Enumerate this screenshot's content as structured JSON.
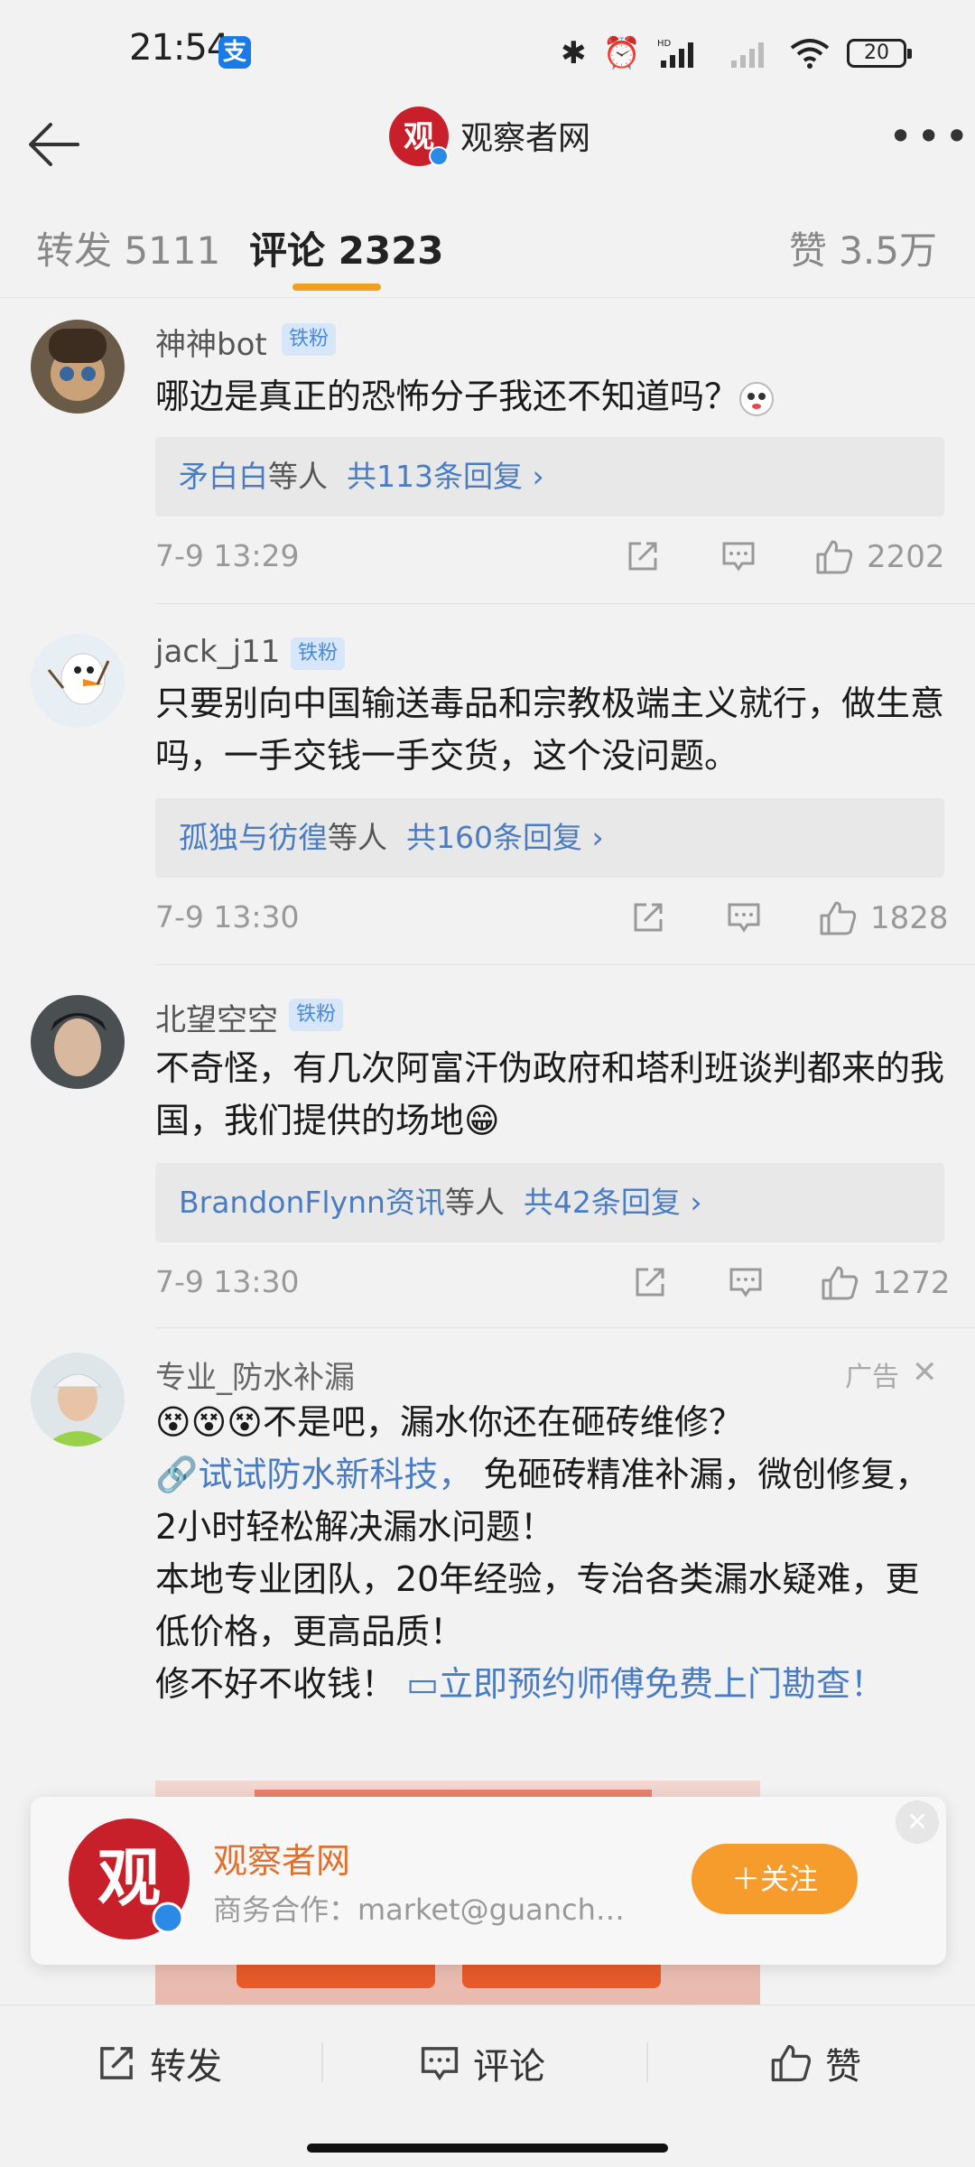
{
  "status_bar": {
    "time": "21:54",
    "alipay": "支",
    "battery": "20"
  },
  "nav": {
    "title": "观察者网"
  },
  "tabs": {
    "repost": "转发 5111",
    "comment": "评论 2323",
    "like": "赞 3.5万"
  },
  "comments": [
    {
      "username": "神神bot",
      "badge": "铁粉",
      "text": "哪边是真正的恐怖分子我还不知道吗？",
      "reply_names": "矛白白",
      "reply_suffix": "等人",
      "reply_count": "共113条回复 ›",
      "time": "7-9 13:29",
      "likes": "2202"
    },
    {
      "username": "jack_j11",
      "badge": "铁粉",
      "text": "只要别向中国输送毒品和宗教极端主义就行，做生意吗，一手交钱一手交货，这个没问题。",
      "reply_names": "孤独与彷徨",
      "reply_suffix": "等人",
      "reply_count": "共160条回复 ›",
      "time": "7-9 13:30",
      "likes": "1828"
    },
    {
      "username": "北望空空",
      "badge": "铁粉",
      "text": "不奇怪，有几次阿富汗伪政府和塔利班谈判都来的我国，我们提供的场地😁",
      "reply_names": "BrandonFlynn资讯",
      "reply_suffix": "等人",
      "reply_count": "共42条回复 ›",
      "time": "7-9 13:30",
      "likes": "1272"
    }
  ],
  "ad": {
    "username": "专业_防水补漏",
    "label": "广告",
    "line1": "😵😵😵不是吧，漏水你还在砸砖维修？",
    "link1": "🔗试试防水新科技，",
    "line2": " 免砸砖精准补漏，微创修复，2小时轻松解决漏水问题！",
    "line3": "本地专业团队，20年经验，专治各类漏水疑难，更低价格，更高品质！",
    "line4": "修不好不收钱！ ",
    "link2": "▭立即预约师傅免费上门勘查！"
  },
  "follow_card": {
    "name": "观察者网",
    "subtitle": "商务合作：market@guanch…",
    "button": "＋关注"
  },
  "bottom_bar": {
    "repost": "转发",
    "comment": "评论",
    "like": "赞"
  }
}
